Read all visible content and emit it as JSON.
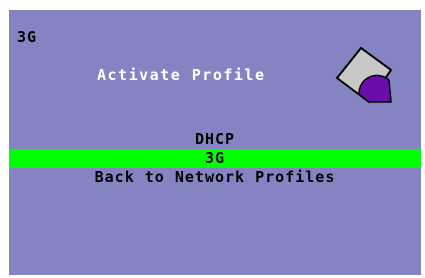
{
  "header": {
    "label": "3G",
    "title": "Activate Profile",
    "icon": "profile-card-icon"
  },
  "menu": {
    "items": [
      {
        "label": "DHCP",
        "selected": false
      },
      {
        "label": "3G",
        "selected": true
      },
      {
        "label": "Back to Network Profiles",
        "selected": false
      }
    ]
  },
  "colors": {
    "background": "#8484c2",
    "highlight": "#00ff00",
    "title_text": "#ffffff",
    "text": "#000000",
    "icon_fill": "#c8c8c8",
    "icon_accent": "#6a0dad"
  }
}
